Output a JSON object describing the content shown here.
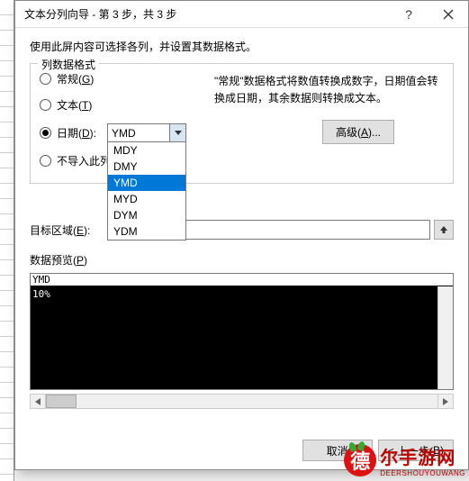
{
  "title": "文本分列向导 - 第 3 步，共 3 步",
  "instruction": "使用此屏内容可选择各列，并设置其数据格式。",
  "format_group": {
    "legend": "列数据格式",
    "general": "常规(G)",
    "text": "文本(T)",
    "date": "日期(D):",
    "skip": "不导入此列",
    "date_value": "YMD",
    "options": [
      "MDY",
      "DMY",
      "YMD",
      "MYD",
      "DYM",
      "YDM"
    ],
    "desc": "\"常规\"数据格式将数值转换成数字，日期值会转换成日期，其余数据则转换成文本。",
    "advanced": "高级(A)..."
  },
  "dest": {
    "label": "目标区域(E):",
    "value": "$"
  },
  "preview": {
    "label": "数据预览(P)",
    "header": "YMD",
    "body": "10%"
  },
  "footer": {
    "cancel": "取消",
    "back": "< 上一步(B)"
  },
  "logo": {
    "char": "德",
    "main": "尔手游网",
    "sub": "DEERSHOUYOUWANG"
  }
}
